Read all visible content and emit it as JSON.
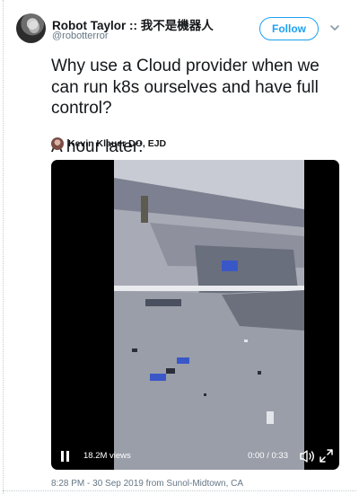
{
  "author": {
    "display_name": "Robot Taylor :: 我不是機器人",
    "handle": "@robotterror"
  },
  "actions": {
    "follow_label": "Follow"
  },
  "tweet": {
    "line1": "Why use a Cloud provider when we can run k8s ourselves and have full control?",
    "line2": "A hour later:"
  },
  "media": {
    "attribution": "Kevin Klauer DO, EJD",
    "views": "18.2M views",
    "time": "0:00 / 0:33"
  },
  "meta": {
    "timestamp": "8:28 PM - 30 Sep 2019",
    "from_label": "from",
    "location": "Sunol-Midtown, CA"
  },
  "colors": {
    "accent": "#1da1f2",
    "muted": "#657786"
  },
  "icons": [
    "chevron-down-icon",
    "play-icon",
    "volume-icon",
    "expand-icon"
  ]
}
